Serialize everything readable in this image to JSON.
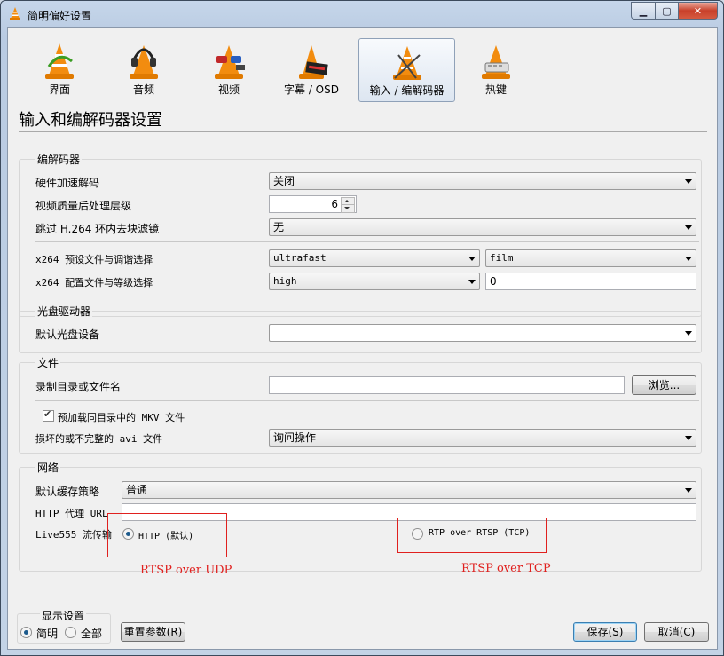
{
  "window": {
    "title": "简明偏好设置"
  },
  "toolbar": {
    "items": [
      {
        "label": "界面",
        "icon": "vlc-cone-icon"
      },
      {
        "label": "音频",
        "icon": "vlc-headphones-icon"
      },
      {
        "label": "视频",
        "icon": "vlc-glasses-icon"
      },
      {
        "label": "字幕 / OSD",
        "icon": "vlc-subtitle-icon"
      },
      {
        "label": "输入 / 编解码器",
        "icon": "vlc-input-icon",
        "selected": true
      },
      {
        "label": "热键",
        "icon": "vlc-hotkeys-icon"
      }
    ]
  },
  "page": {
    "heading": "输入和编解码器设置"
  },
  "codecs": {
    "title": "编解码器",
    "hw_label": "硬件加速解码",
    "hw_value": "关闭",
    "quality_label": "视频质量后处理层级",
    "quality_value": "6",
    "skip_label": "跳过 H.264 环内去块滤镜",
    "skip_value": "无",
    "preset_label": "x264 预设文件与调谐选择",
    "preset_value": "ultrafast",
    "tune_value": "film",
    "profile_label": "x264 配置文件与等级选择",
    "profile_value": "high",
    "level_value": "0"
  },
  "optical": {
    "title": "光盘驱动器",
    "device_label": "默认光盘设备",
    "device_value": ""
  },
  "files": {
    "title": "文件",
    "record_label": "录制目录或文件名",
    "record_value": "",
    "browse_label": "浏览...",
    "mkv_label": "预加载同目录中的 MKV 文件",
    "avi_label": "损坏的或不完整的 avi 文件",
    "avi_value": "询问操作"
  },
  "network": {
    "title": "网络",
    "cache_label": "默认缓存策略",
    "cache_value": "普通",
    "proxy_label": "HTTP 代理 URL",
    "proxy_value": "",
    "live_label": "Live555 流传输",
    "http_option": "HTTP (默认)",
    "rtsp_option": "RTP over RTSP (TCP)"
  },
  "annotations": {
    "udp": "RTSP over UDP",
    "tcp": "RTSP over TCP",
    "color": "#e0201e"
  },
  "footer": {
    "display_title": "显示设置",
    "simple": "简明",
    "all": "全部",
    "reset": "重置参数(R)",
    "save": "保存(S)",
    "cancel": "取消(C)"
  }
}
